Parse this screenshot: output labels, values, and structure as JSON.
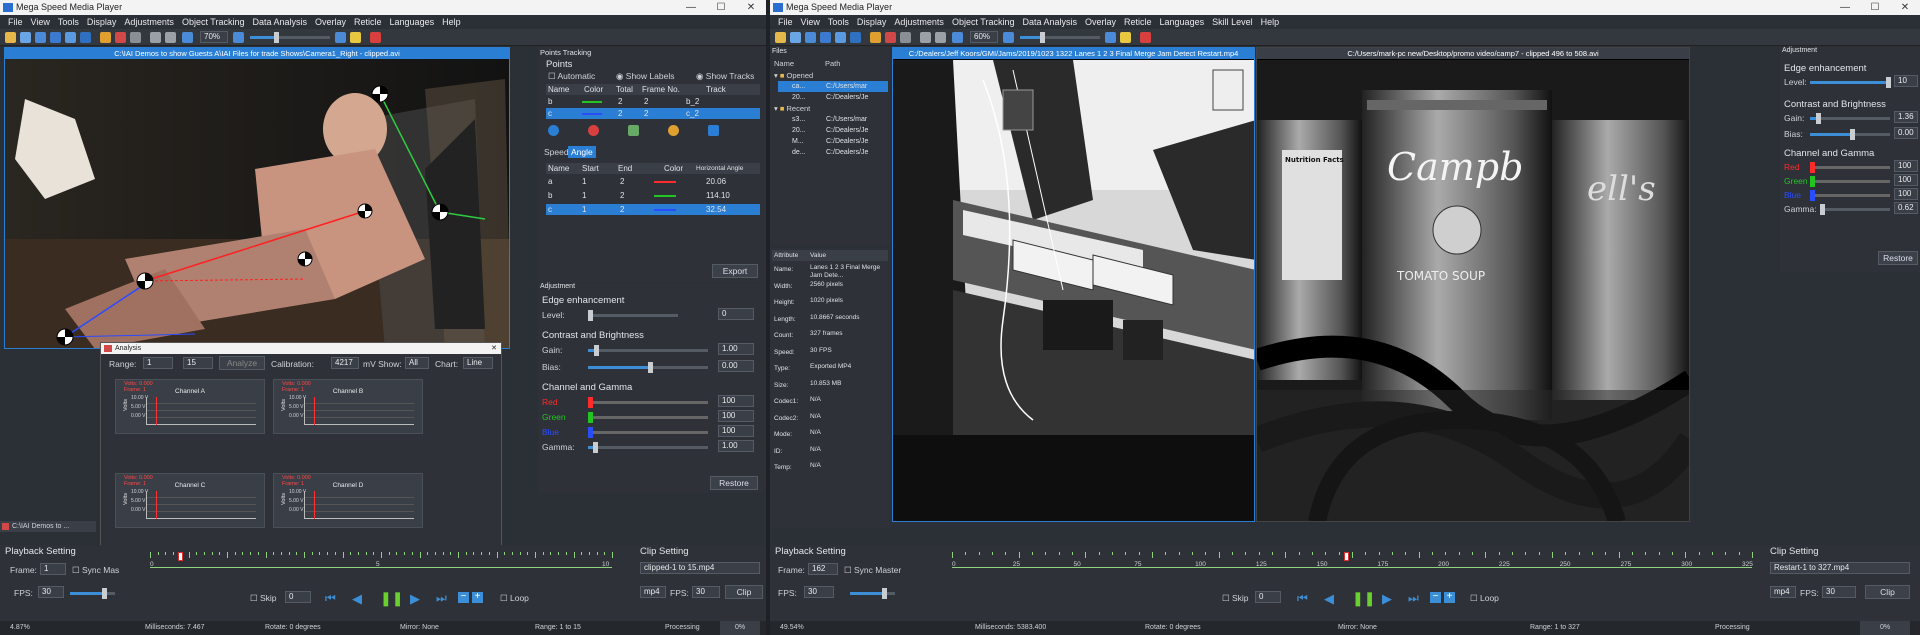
{
  "left": {
    "title": "Mega Speed Media Player",
    "menu": [
      "File",
      "View",
      "Tools",
      "Display",
      "Adjustments",
      "Object Tracking",
      "Data Analysis",
      "Overlay",
      "Reticle",
      "Languages",
      "Help"
    ],
    "zoom": "70%",
    "video_title": "C:\\IAI Demos to show Guests A\\IAI Files for trade Shows\\Camera1_Right - clipped.avi",
    "points_tracking": {
      "header": "Points Tracking",
      "points_label": "Points",
      "automatic": "Automatic",
      "show_labels": "Show Labels",
      "show_tracks": "Show Tracks",
      "columns": [
        "Name",
        "Color",
        "Total",
        "Frame No.",
        "Track"
      ],
      "rows": [
        {
          "name": "b",
          "total": "2",
          "frame": "2",
          "track": "b_2"
        },
        {
          "name": "c",
          "total": "2",
          "frame": "2",
          "track": "c_2"
        }
      ],
      "tabs": [
        "Speed",
        "Angle"
      ],
      "angle_columns": [
        "Name",
        "Start",
        "End",
        "Color",
        "Horizontal Angle"
      ],
      "angle_rows": [
        {
          "name": "a",
          "start": "1",
          "end": "2",
          "angle": "20.06"
        },
        {
          "name": "b",
          "start": "1",
          "end": "2",
          "angle": "114.10"
        },
        {
          "name": "c",
          "start": "1",
          "end": "2",
          "angle": "32.54"
        }
      ],
      "export": "Export"
    },
    "adjustment": {
      "header": "Adjustment",
      "edge": "Edge enhancement",
      "level": "Level:",
      "level_val": "0",
      "contrast": "Contrast and Brightness",
      "gain": "Gain:",
      "gain_val": "1.00",
      "bias": "Bias:",
      "bias_val": "0.00",
      "channel": "Channel and Gamma",
      "red": "Red",
      "green": "Green",
      "blue": "Blue",
      "gamma": "Gamma:",
      "red_val": "100",
      "green_val": "100",
      "blue_val": "100",
      "gamma_val": "1.00",
      "restore": "Restore"
    },
    "analysis": {
      "title": "Analysis",
      "range": "Range:",
      "from": "1",
      "to": "15",
      "analyze": "Analyze",
      "calibration": "Calibration:",
      "cal_val": "4217",
      "mv_show": "mV Show:",
      "show_val": "All",
      "chart": "Chart:",
      "chart_val": "Line",
      "channels": [
        {
          "name": "Channel A"
        },
        {
          "name": "Channel B"
        },
        {
          "name": "Channel C"
        },
        {
          "name": "Channel D"
        }
      ],
      "volts_label": "Volts",
      "v1": "10.00 V",
      "v2": "5.00 V",
      "v3": "0.00 V",
      "sel_text": "Volts: 0.000",
      "frame_text": "Frame: 1"
    },
    "minimized": "C:\\IAI Demos to ...",
    "playback": {
      "header": "Playback Setting",
      "frame": "Frame:",
      "frame_val": "1",
      "sync": "Sync Mas",
      "fps": "FPS:",
      "fps_val": "30",
      "skip": "Skip",
      "skip_val": "0",
      "loop": "Loop"
    },
    "timeline": {
      "marks": [
        "0",
        "5",
        "10"
      ]
    },
    "clip": {
      "header": "Clip Setting",
      "value": "clipped-1 to 15.mp4",
      "fmt": "mp4",
      "fps": "FPS:",
      "fps_val": "30",
      "clip": "Clip"
    },
    "status": {
      "pct": "4.87%",
      "ms": "Milliseconds: 7.467",
      "rotate": "Rotate: 0 degrees",
      "mirror": "Mirror: None",
      "range": "Range: 1 to 15",
      "processing": "Processing",
      "proc_val": "0%"
    }
  },
  "right": {
    "title": "Mega Speed Media Player",
    "menu": [
      "File",
      "View",
      "Tools",
      "Display",
      "Adjustments",
      "Object Tracking",
      "Data Analysis",
      "Overlay",
      "Reticle",
      "Languages",
      "Skill Level",
      "Help"
    ],
    "zoom": "60%",
    "files": {
      "header": "Files",
      "name_col": "Name",
      "path_col": "Path",
      "opened": "Opened",
      "recent": "Recent",
      "opened_items": [
        {
          "name": "ca...",
          "path": "C:/Users/mar"
        },
        {
          "name": "20...",
          "path": "C:/Dealers/Je"
        }
      ],
      "recent_items": [
        {
          "name": "s3...",
          "path": "C:/Users/mar"
        },
        {
          "name": "20...",
          "path": "C:/Dealers/Je"
        },
        {
          "name": "M...",
          "path": "C:/Dealers/Je"
        },
        {
          "name": "de...",
          "path": "C:/Dealers/Je"
        }
      ]
    },
    "attributes": {
      "col1": "Attribute",
      "col2": "Value",
      "rows": [
        {
          "k": "Name:",
          "v": "Lanes 1 2 3 Final Merge Jam Dete..."
        },
        {
          "k": "Width:",
          "v": "2560 pixels"
        },
        {
          "k": "Height:",
          "v": "1020 pixels"
        },
        {
          "k": "Length:",
          "v": "10.8667 seconds"
        },
        {
          "k": "Count:",
          "v": "327 frames"
        },
        {
          "k": "Speed:",
          "v": "30 FPS"
        },
        {
          "k": "Type:",
          "v": "Exported MP4"
        },
        {
          "k": "Size:",
          "v": "10.853 MB"
        },
        {
          "k": "Codec1:",
          "v": "N/A"
        },
        {
          "k": "Codec2:",
          "v": "N/A"
        },
        {
          "k": "Mode:",
          "v": "N/A"
        },
        {
          "k": "ID:",
          "v": "N/A"
        },
        {
          "k": "Temp:",
          "v": "N/A"
        }
      ]
    },
    "video1_title": "C:/Dealers/Jeff Koors/GMI/Jams/2019/1023 1322 Lanes 1 2 3 Final Merge Jam Detect Restart.mp4",
    "video2_title": "C:/Users/mark-pc new/Desktop/promo video/camp7 - clipped 496 to 508.avi",
    "adjustment": {
      "header": "Adjustment",
      "edge": "Edge enhancement",
      "level": "Level:",
      "level_val": "10",
      "contrast": "Contrast and Brightness",
      "gain": "Gain:",
      "gain_val": "1.36",
      "bias": "Bias:",
      "bias_val": "0.00",
      "channel": "Channel and Gamma",
      "red": "Red",
      "green": "Green",
      "blue": "Blue",
      "gamma": "Gamma:",
      "red_val": "100",
      "green_val": "100",
      "blue_val": "100",
      "gamma_val": "0.62",
      "restore": "Restore"
    },
    "playback": {
      "header": "Playback Setting",
      "frame": "Frame:",
      "frame_val": "162",
      "sync": "Sync Master",
      "fps": "FPS:",
      "fps_val": "30",
      "skip": "Skip",
      "skip_val": "0",
      "loop": "Loop"
    },
    "timeline": {
      "marks": [
        "0",
        "25",
        "50",
        "75",
        "100",
        "125",
        "150",
        "175",
        "200",
        "225",
        "250",
        "275",
        "300",
        "325"
      ]
    },
    "clip": {
      "header": "Clip Setting",
      "value": "Restart-1 to 327.mp4",
      "fmt": "mp4",
      "fps": "FPS:",
      "fps_val": "30",
      "clip": "Clip"
    },
    "status": {
      "pct": "49.54%",
      "ms": "Milliseconds: 5383.400",
      "rotate": "Rotate: 0 degrees",
      "mirror": "Mirror: None",
      "range": "Range: 1 to 327",
      "processing": "Processing",
      "proc_val": "0%"
    },
    "can_label_1": "Campb",
    "can_label_2": "ell's",
    "tomato": "TOMATO SOUP",
    "nutrition": "Nutrition Facts"
  },
  "colors": {
    "accent": "#2a7fd4",
    "red": "#ff2a2a",
    "green": "#22c422",
    "blue": "#2a4cff",
    "timeline_tick": "#8fd37c"
  }
}
